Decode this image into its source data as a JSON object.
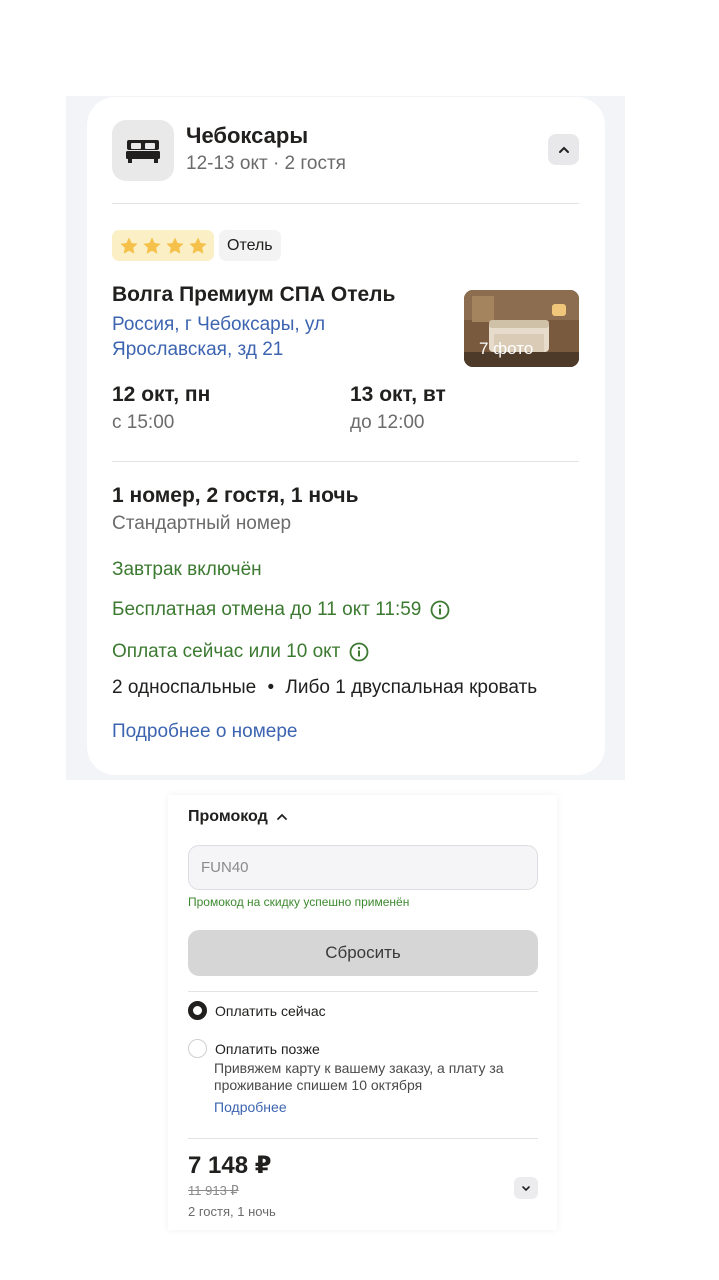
{
  "booking": {
    "city": "Чебоксары",
    "dates_guests": "12-13 окт · 2 гостя",
    "icons": {
      "bed": "bed-icon",
      "collapse": "chevron-up-icon"
    }
  },
  "hotel": {
    "stars": 4,
    "type": "Отель",
    "name": "Волга Премиум СПА Отель",
    "address": "Россия, г Чебоксары, ул Ярославская, зд 21",
    "photo_label": "7 фото"
  },
  "stay": {
    "checkin_date": "12 окт, пн",
    "checkin_time": "с 15:00",
    "checkout_date": "13 окт, вт",
    "checkout_time": "до 12:00"
  },
  "room": {
    "summary": "1 номер, 2 гостя, 1 ночь",
    "type": "Стандартный номер",
    "breakfast": "Завтрак включён",
    "cancellation": "Бесплатная отмена до 11 окт 11:59",
    "payment": "Оплата сейчас или 10 окт",
    "beds_left": "2 односпальные",
    "beds_sep": "•",
    "beds_right": "Либо 1 двуспальная кровать",
    "more_link": "Подробнее о номере"
  },
  "promo": {
    "title": "Промокод",
    "value": "FUN40",
    "success": "Промокод на скидку успешно применён",
    "reset_label": "Сбросить"
  },
  "payment_options": {
    "pay_now": "Оплатить сейчас",
    "pay_later": "Оплатить позже",
    "pay_later_note": "Привяжем карту к вашему заказу, а плату за проживание спишем 10 октября",
    "pay_later_link": "Подробнее",
    "selected": "pay_now"
  },
  "total": {
    "price": "7 148 ₽",
    "old_price": "11 913 ₽",
    "details": "2 гостя, 1 ночь"
  },
  "colors": {
    "accent_link": "#3d64b0",
    "success_green": "#3c7a31",
    "star_yellow": "#f5c14b"
  }
}
